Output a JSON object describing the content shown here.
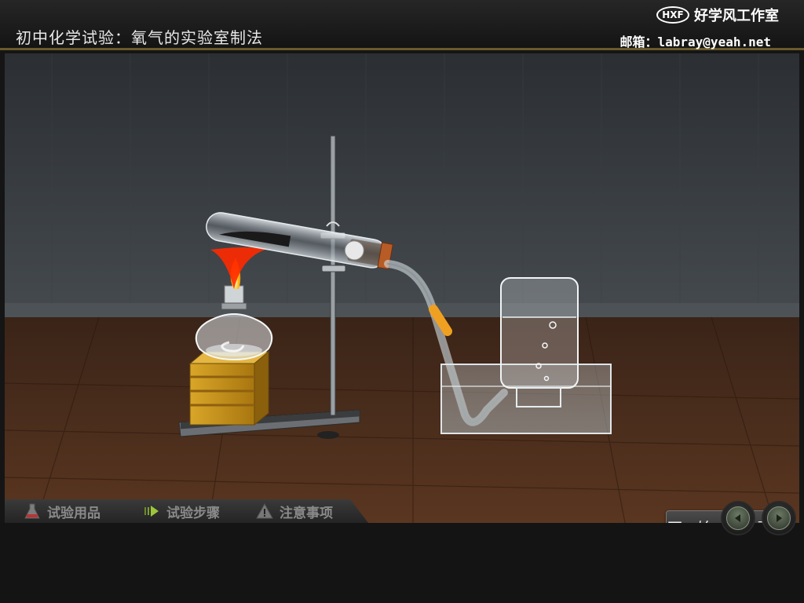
{
  "header": {
    "title": "初中化学试验：氧气的实验室制法",
    "brand_logo": "HXF",
    "brand_name": "好学风工作室",
    "email": "邮箱：labray@yeah.net"
  },
  "stage": {
    "start_button_label": "开 始 实 验"
  },
  "tabs": [
    {
      "label": "试验用品",
      "icon": "flask-icon"
    },
    {
      "label": "试验步骤",
      "icon": "steps-arrow-icon"
    },
    {
      "label": "注意事项",
      "icon": "warning-icon"
    }
  ],
  "nav": {
    "prev_icon": "arrow-left-icon",
    "next_icon": "arrow-right-icon"
  },
  "colors": {
    "header_bg": "#1c1c1c",
    "accent_gold": "#6b5a2a",
    "flame": "#ff9a1a",
    "wood_block": "#c8961e",
    "hose": "#f0a020"
  }
}
